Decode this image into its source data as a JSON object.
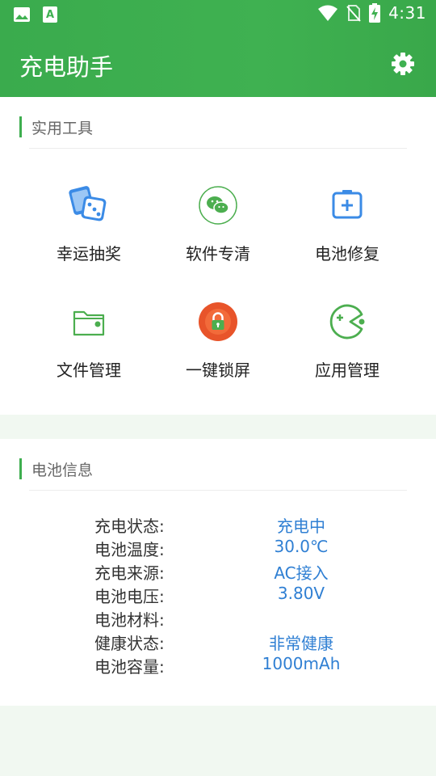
{
  "status_bar": {
    "time": "4:31",
    "left_icons": [
      "image-icon",
      "app-store-icon"
    ],
    "right_icons": [
      "wifi-icon",
      "no-sim-icon",
      "battery-charging-icon"
    ]
  },
  "app_bar": {
    "title": "充电助手",
    "settings_icon": "gear-icon"
  },
  "tools_section": {
    "title": "实用工具",
    "items": [
      {
        "label": "幸运抽奖",
        "icon": "dice-icon"
      },
      {
        "label": "软件专清",
        "icon": "wechat-icon"
      },
      {
        "label": "电池修复",
        "icon": "battery-repair-icon"
      },
      {
        "label": "文件管理",
        "icon": "folder-icon"
      },
      {
        "label": "一键锁屏",
        "icon": "lock-icon"
      },
      {
        "label": "应用管理",
        "icon": "pacman-icon"
      }
    ]
  },
  "battery_section": {
    "title": "电池信息",
    "rows": [
      {
        "key": "充电状态:",
        "value": "充电中"
      },
      {
        "key": "电池温度:",
        "value": "30.0℃"
      },
      {
        "key": "充电来源:",
        "value": "AC接入"
      },
      {
        "key": "电池电压:",
        "value": "3.80V"
      },
      {
        "key": "电池材料:",
        "value": ""
      },
      {
        "key": "健康状态:",
        "value": "非常健康"
      },
      {
        "key": "电池容量:",
        "value": "1000mAh"
      }
    ]
  },
  "colors": {
    "brand_green": "#3fb151",
    "value_blue": "#2f7fd3",
    "lock_orange": "#e8542a"
  }
}
